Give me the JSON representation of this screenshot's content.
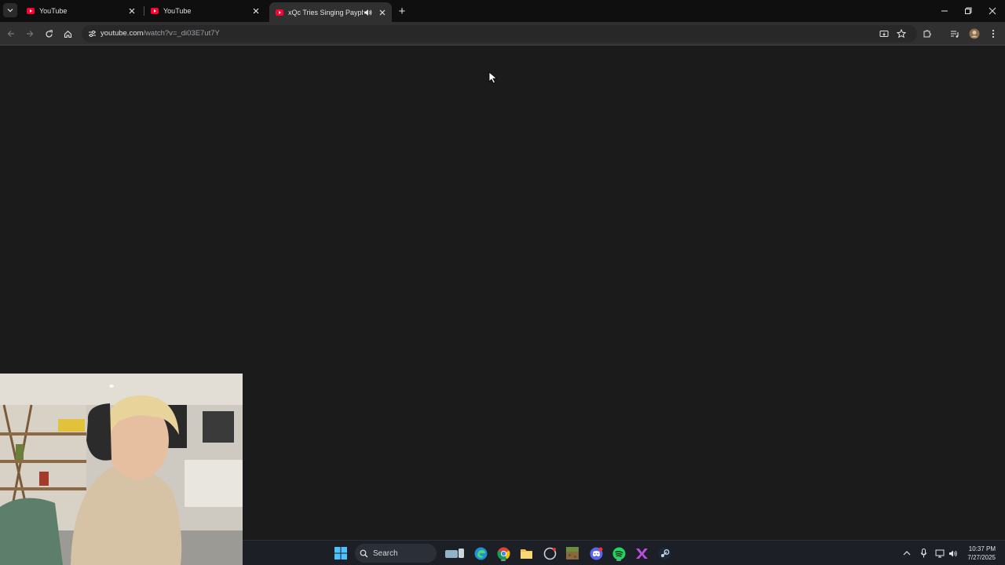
{
  "browser": {
    "tabs": [
      {
        "title": "YouTube",
        "active": false
      },
      {
        "title": "YouTube",
        "active": false
      },
      {
        "title": "xQc Tries Singing Payphone",
        "active": true,
        "audio": true
      }
    ],
    "new_tab_symbol": "+",
    "url_domain": "youtube.com",
    "url_path": "/watch?v=_di03E7ut7Y"
  },
  "taskbar": {
    "search_label": "Search",
    "time": "10:37 PM",
    "date": "7/27/2025",
    "apps": [
      "windows-start-icon",
      "search-icon",
      "widgets-icon",
      "edge-icon",
      "chrome-icon",
      "file-explorer-icon",
      "ccleaner-icon",
      "minecraft-icon",
      "discord-icon",
      "spotify-icon",
      "yandex-icon",
      "steam-icon"
    ]
  },
  "colors": {
    "youtube_red": "#ff0033",
    "page_background": "#1b1b1b",
    "tab_bar": "#0f0f0f",
    "toolbar": "#303030",
    "taskbar": "#1c1f26"
  }
}
